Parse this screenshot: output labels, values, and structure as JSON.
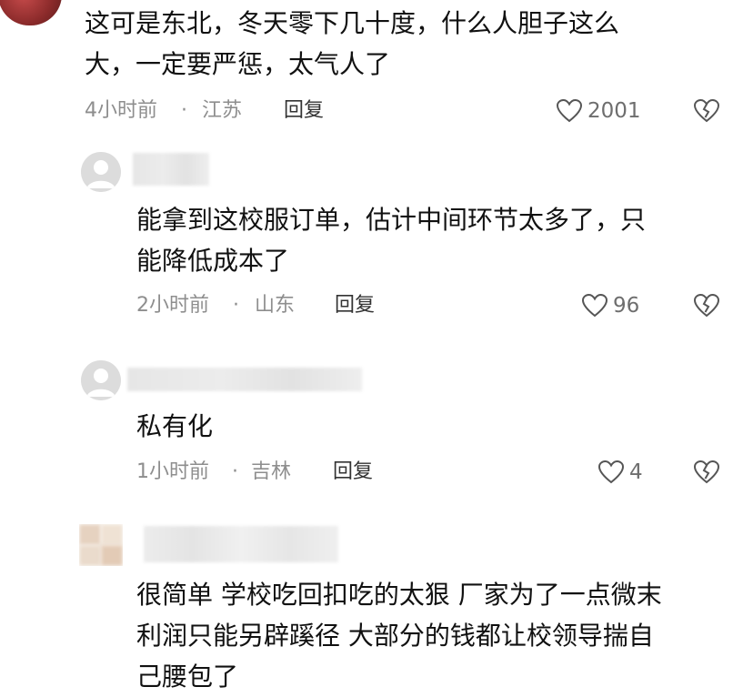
{
  "colors": {
    "background": "#ffffff",
    "meta_text": "#8e8e8e",
    "main_text": "#111111",
    "icon_stroke": "#555555"
  },
  "comments": [
    {
      "lines": [
        "这可是东北，冬天零下几十度，什么人胆子这么",
        "大，一定要严惩，太气人了"
      ],
      "time": "4小时前",
      "location": "江苏",
      "reply_label": "回复",
      "likes": "2001"
    },
    {
      "lines": [
        "能拿到这校服订单，估计中间环节太多了，只",
        "能降低成本了"
      ],
      "time": "2小时前",
      "location": "山东",
      "reply_label": "回复",
      "likes": "96"
    },
    {
      "lines": [
        "私有化"
      ],
      "time": "1小时前",
      "location": "吉林",
      "reply_label": "回复",
      "likes": "4"
    },
    {
      "lines": [
        "很简单 学校吃回扣吃的太狠 厂家为了一点微末",
        "利润只能另辟蹊径 大部分的钱都让校领导揣自",
        "己腰包了"
      ]
    }
  ],
  "separator": "·",
  "icons": {
    "like": "heart-outline-icon",
    "dislike": "broken-heart-icon",
    "avatar": "default-avatar-icon"
  }
}
